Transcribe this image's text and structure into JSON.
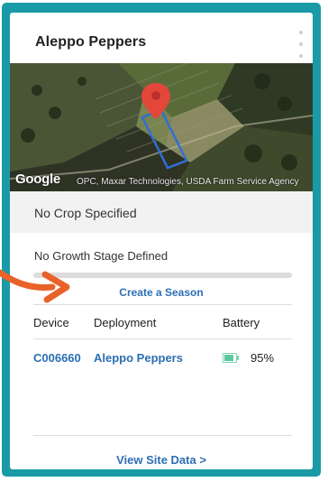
{
  "card": {
    "title": "Aleppo Peppers",
    "menu_icon": "vertical-ellipsis-icon"
  },
  "map": {
    "logo_text": "Google",
    "attribution": "OPC, Maxar Technologies, USDA Farm Service Agency",
    "marker_icon": "map-pin-icon",
    "marker_color": "#e5463a",
    "field_outline_color": "#2f6fd6"
  },
  "crop": {
    "label": "No Crop Specified"
  },
  "growth": {
    "label": "No Growth Stage Defined",
    "progress": 0
  },
  "season": {
    "create_label": "Create a Season"
  },
  "table": {
    "headers": {
      "device": "Device",
      "deployment": "Deployment",
      "battery": "Battery"
    },
    "rows": [
      {
        "device": "C006660",
        "deployment": "Aleppo Peppers",
        "battery_pct": "95%",
        "battery_level": 0.95
      }
    ]
  },
  "footer": {
    "view_site_label": "View Site Data >"
  },
  "colors": {
    "frame_accent": "#1a9aa6",
    "link": "#2c6fb3",
    "annotation_arrow": "#e8622a",
    "battery": "#5dc79e"
  }
}
